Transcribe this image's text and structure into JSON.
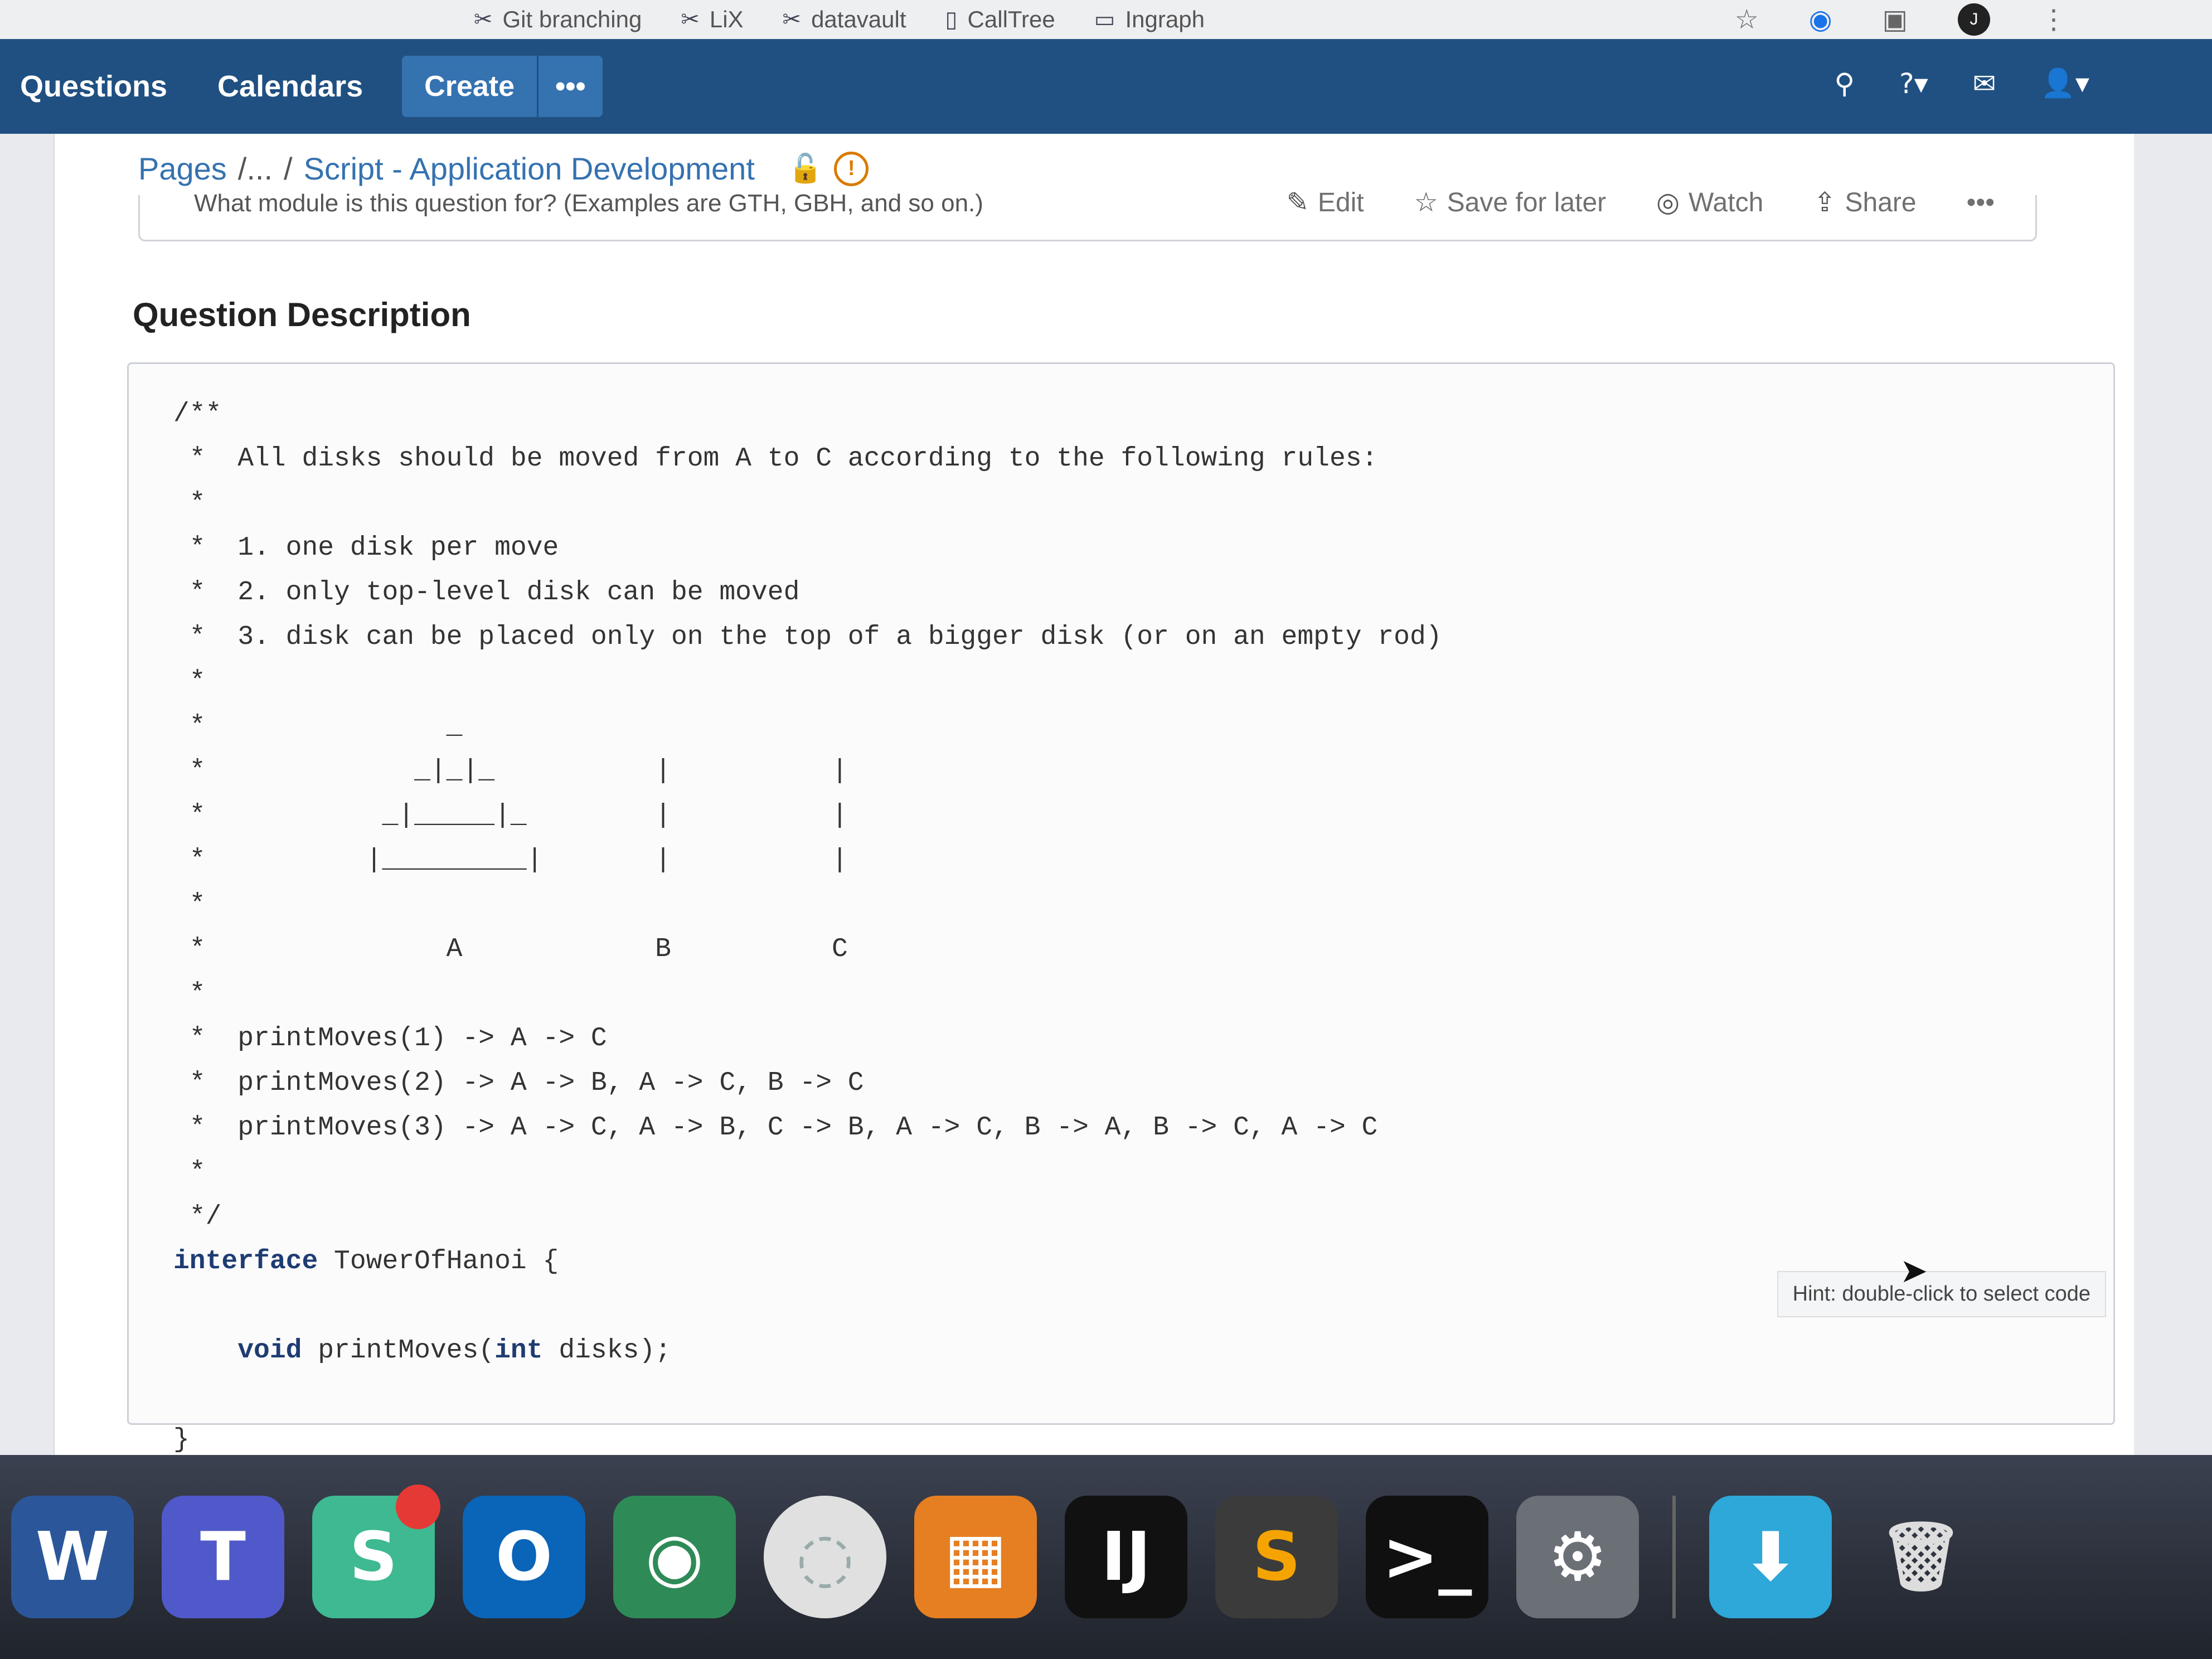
{
  "browser": {
    "bookmarks": [
      {
        "icon": "tools-icon",
        "label": "Git branching"
      },
      {
        "icon": "tools-icon",
        "label": "LiX"
      },
      {
        "icon": "tools-icon",
        "label": "datavault"
      },
      {
        "icon": "page-icon",
        "label": "CallTree"
      },
      {
        "icon": "folder-icon",
        "label": "Ingraph"
      }
    ],
    "profile_initial": "J"
  },
  "app_nav": {
    "links": [
      "Questions",
      "Calendars"
    ],
    "create_label": "Create",
    "more_label": "•••"
  },
  "page": {
    "breadcrumb": [
      "Pages",
      "/...",
      "/",
      "Script - Application Development"
    ],
    "actions": [
      {
        "icon": "pencil-icon",
        "label": "Edit"
      },
      {
        "icon": "star-icon",
        "label": "Save for later"
      },
      {
        "icon": "eye-icon",
        "label": "Watch"
      },
      {
        "icon": "share-icon",
        "label": "Share"
      },
      {
        "icon": "more-icon",
        "label": "•••"
      }
    ],
    "cut_off_text": "What module is this question for? (Examples are GTH, GBH, and so on.)",
    "section_title": "Question Description",
    "code_lines": [
      "/**",
      " *  All disks should be moved from A to C according to the following rules:",
      " *",
      " *  1. one disk per move",
      " *  2. only top-level disk can be moved",
      " *  3. disk can be placed only on the top of a bigger disk (or on an empty rod)",
      " *",
      " *               _",
      " *             _|_|_          |          |",
      " *           _|_____|_        |          |",
      " *          |_________|       |          |",
      " *",
      " *               A            B          C",
      " *",
      " *  printMoves(1) -> A -> C",
      " *  printMoves(2) -> A -> B, A -> C, B -> C",
      " *  printMoves(3) -> A -> C, A -> B, C -> B, A -> C, B -> A, B -> C, A -> C",
      " *",
      " */"
    ],
    "code_interface_kw": "interface",
    "code_interface_name": " TowerOfHanoi {",
    "code_method_void": "void",
    "code_method_rest1": " printMoves(",
    "code_method_int": "int",
    "code_method_rest2": " disks);",
    "code_close": "}",
    "hint": "Hint: double-click to select code"
  },
  "dock": {
    "apps": [
      {
        "name": "word-icon",
        "glyph": "W",
        "color": "#2b579a"
      },
      {
        "name": "teams-icon",
        "glyph": "T",
        "color": "#5059c9"
      },
      {
        "name": "slack-icon",
        "glyph": "S",
        "color": "#3eb991"
      },
      {
        "name": "outlook-icon",
        "glyph": "O",
        "color": "#0a64b8"
      },
      {
        "name": "vpn-icon",
        "glyph": "◉",
        "color": "#2e8b57"
      },
      {
        "name": "wifi-icon",
        "glyph": "◌",
        "color": "#e0e0e0"
      },
      {
        "name": "app-icon",
        "glyph": "▦",
        "color": "#e67e22"
      },
      {
        "name": "intellij-icon",
        "glyph": "IJ",
        "color": "#111111"
      },
      {
        "name": "sublime-icon",
        "glyph": "S",
        "color": "#3b3b3b"
      },
      {
        "name": "terminal-icon",
        "glyph": ">_",
        "color": "#101010"
      },
      {
        "name": "system-preferences-icon",
        "glyph": "⚙",
        "color": "#6b6f76"
      }
    ]
  }
}
